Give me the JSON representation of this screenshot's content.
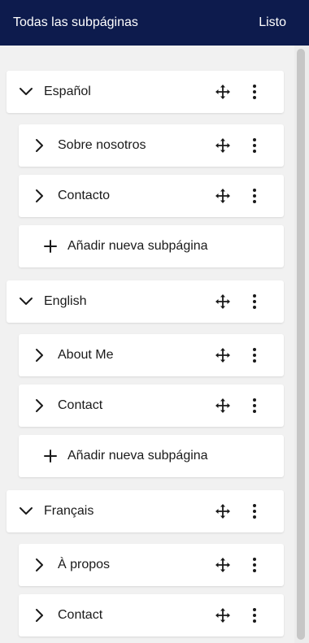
{
  "header": {
    "title": "Todas las subpáginas",
    "done_label": "Listo"
  },
  "languages": [
    {
      "name": "Español",
      "subpages": [
        "Sobre nosotros",
        "Contacto"
      ],
      "add_label": "Añadir nueva subpágina"
    },
    {
      "name": "English",
      "subpages": [
        "About Me",
        "Contact"
      ],
      "add_label": "Añadir nueva subpágina"
    },
    {
      "name": "Français",
      "subpages": [
        "À propos",
        "Contact"
      ]
    }
  ],
  "icons": {
    "expanded": "chevron-down-icon",
    "collapsed": "chevron-right-icon",
    "move": "move-icon",
    "more": "more-vertical-icon",
    "add": "plus-icon"
  },
  "colors": {
    "header_bg": "#0d1b4d",
    "header_text": "#ffffff",
    "list_bg": "#f1f1f1",
    "card_bg": "#ffffff",
    "text": "#1a1a1a"
  }
}
